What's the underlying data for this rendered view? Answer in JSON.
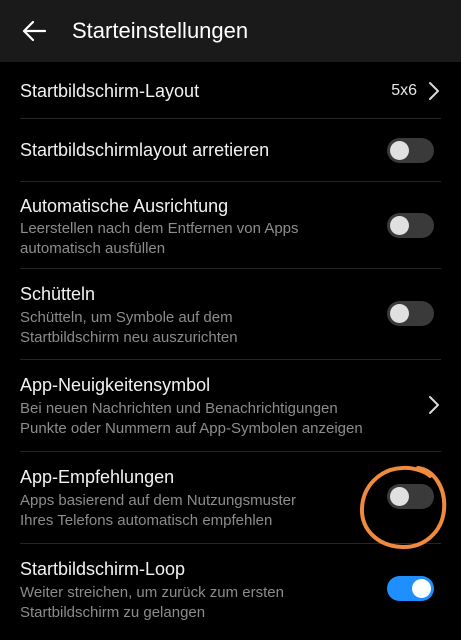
{
  "header": {
    "title": "Starteinstellungen"
  },
  "colors": {
    "background": "#000000",
    "appbar": "#1a1a1a",
    "toggle_on": "#1f8fff",
    "toggle_off": "#3a3a3a",
    "annotation": "#f08a3c"
  },
  "icons": {
    "back": "arrow-left-icon",
    "chevron": "chevron-right-icon"
  },
  "settings": [
    {
      "title": "Startbildschirm-Layout",
      "value": "5x6",
      "control": "chevron"
    },
    {
      "title": "Startbildschirmlayout arretieren",
      "control": "toggle",
      "on": false
    },
    {
      "title": "Automatische Ausrichtung",
      "subtitle_1": "Leerstellen nach dem Entfernen von Apps",
      "subtitle_2": "automatisch ausfüllen",
      "control": "toggle",
      "on": false
    },
    {
      "title": "Schütteln",
      "subtitle_1": "Schütteln, um Symbole auf dem",
      "subtitle_2": "Startbildschirm neu auszurichten",
      "control": "toggle",
      "on": false
    },
    {
      "title": "App-Neuigkeitensymbol",
      "subtitle_1": "Bei neuen Nachrichten und Benachrichtigungen",
      "subtitle_2": "Punkte oder Nummern auf App-Symbolen anzeigen",
      "control": "chevron"
    },
    {
      "title": "App-Empfehlungen",
      "subtitle_1": "Apps basierend auf dem Nutzungsmuster",
      "subtitle_2": "Ihres Telefons automatisch empfehlen",
      "control": "toggle",
      "on": false,
      "annotated": true
    },
    {
      "title": "Startbildschirm-Loop",
      "subtitle_1": "Weiter streichen, um zurück zum ersten",
      "subtitle_2": "Startbildschirm zu gelangen",
      "control": "toggle",
      "on": true
    }
  ]
}
